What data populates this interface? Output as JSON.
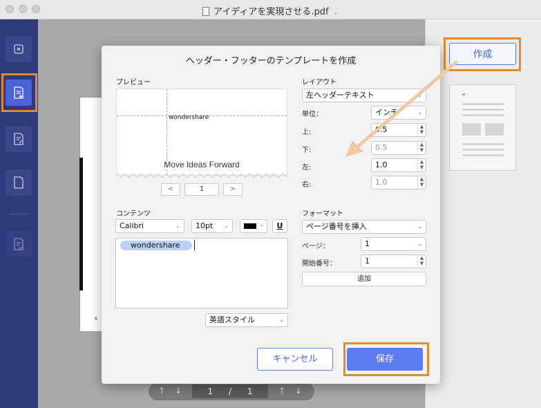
{
  "window": {
    "title": "アイディアを実現させる.pdf",
    "title_chevron": "⌄"
  },
  "sidebar": {
    "items": [
      {
        "name": "close-doc"
      },
      {
        "name": "header-footer",
        "active": true
      },
      {
        "name": "edit-doc"
      },
      {
        "name": "blank-page"
      },
      {
        "name": "checklist-doc"
      }
    ]
  },
  "document": {
    "page_mark": "R",
    "pager": {
      "current": "1",
      "separator": "/",
      "total": "1"
    }
  },
  "right_panel": {
    "create_label": "作成"
  },
  "dialog": {
    "title": "ヘッダー・フッターのテンプレートを作成",
    "preview": {
      "label": "プレビュー",
      "header_text": "wondershare",
      "body_text": "Move Ideas Forward",
      "prev_label": "<",
      "page_value": "1",
      "next_label": ">"
    },
    "layout": {
      "label": "レイアウト",
      "position_select": "左ヘッダーテキスト",
      "unit_label": "単位：",
      "unit_select": "インチ",
      "top_label": "上:",
      "top_value": "0.5",
      "bottom_label": "下:",
      "bottom_value": "0.5",
      "left_label": "左:",
      "left_value": "1.0",
      "right_label": "右:",
      "right_value": "1.0"
    },
    "contents": {
      "label": "コンテンツ",
      "font_select": "Calibri",
      "size_select": "10pt",
      "underline_label": "U",
      "chip_text": "wondershare",
      "style_select": "英語スタイル"
    },
    "format": {
      "label": "フォーマット",
      "insert_select": "ページ番号を挿入",
      "page_label": "ページ：",
      "page_select": "1",
      "start_label": "開始番号：",
      "start_value": "1",
      "add_label": "追加"
    },
    "cancel_label": "キャンセル",
    "save_label": "保存"
  },
  "colors": {
    "accent": "#5b7bf0",
    "highlight": "#e58a2c",
    "sidebar": "#2e3a7a"
  }
}
